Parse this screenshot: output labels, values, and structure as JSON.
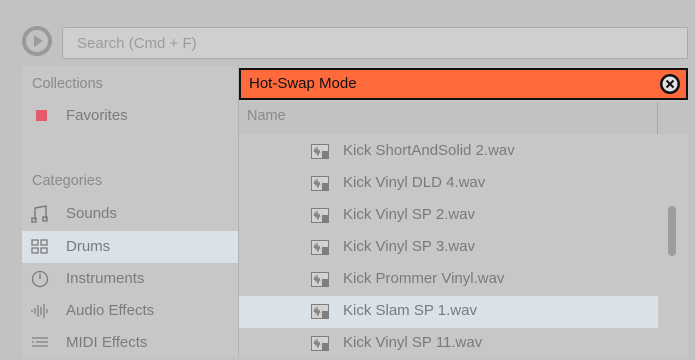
{
  "search": {
    "placeholder": "Search (Cmd + F)"
  },
  "left_panel": {
    "collections_title": "Collections",
    "collections": [
      {
        "label": "Favorites",
        "color": "#e45a6a"
      }
    ],
    "categories_title": "Categories",
    "categories": [
      {
        "label": "Sounds",
        "icon": "note-icon",
        "selected": false
      },
      {
        "label": "Drums",
        "icon": "grid-icon",
        "selected": true
      },
      {
        "label": "Instruments",
        "icon": "clock-icon",
        "selected": false
      },
      {
        "label": "Audio Effects",
        "icon": "waveform-icon",
        "selected": false
      },
      {
        "label": "MIDI Effects",
        "icon": "midi-icon",
        "selected": false
      }
    ]
  },
  "hotswap": {
    "label": "Hot-Swap Mode",
    "color": "#ff6a3d"
  },
  "file_list": {
    "column_header": "Name",
    "files": [
      {
        "name": "Kick ShortAndSolid 2.wav",
        "selected": false
      },
      {
        "name": "Kick Vinyl DLD 4.wav",
        "selected": false
      },
      {
        "name": "Kick Vinyl SP 2.wav",
        "selected": false
      },
      {
        "name": "Kick Vinyl SP 3.wav",
        "selected": false
      },
      {
        "name": "Kick Prommer Vinyl.wav",
        "selected": false
      },
      {
        "name": "Kick Slam SP 1.wav",
        "selected": true
      },
      {
        "name": "Kick Vinyl SP 11.wav",
        "selected": false
      }
    ]
  },
  "colors": {
    "selection": "#d9e2e8",
    "panel": "#c7c7c7",
    "accent": "#ff6a3d"
  }
}
